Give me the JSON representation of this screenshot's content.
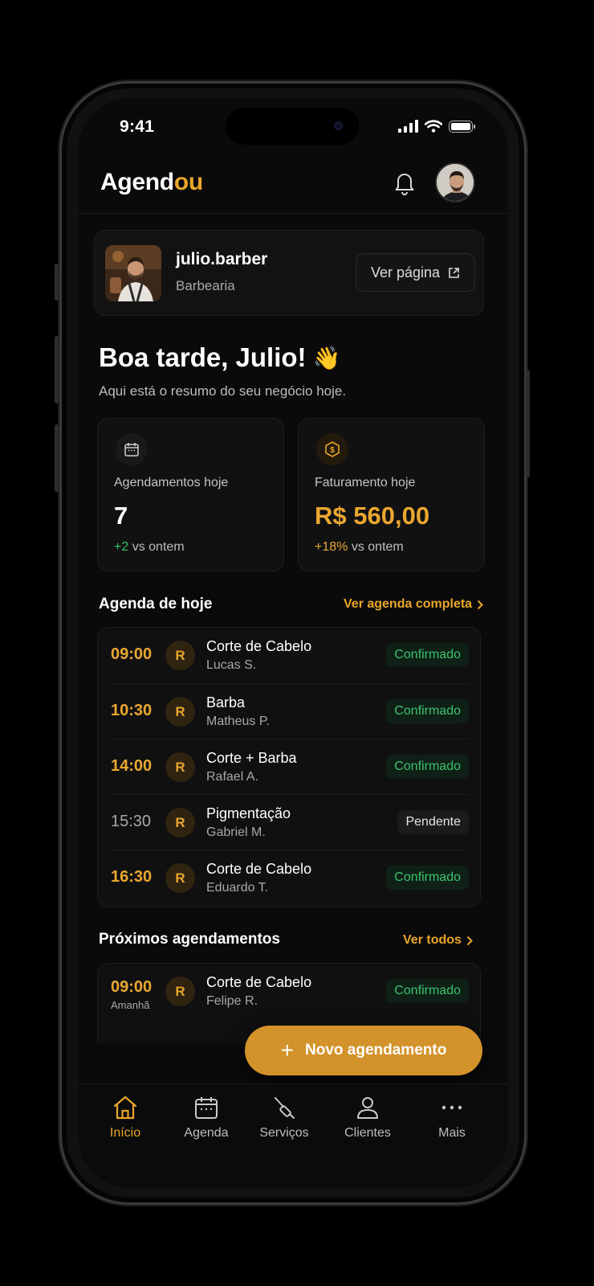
{
  "status_bar": {
    "time": "9:41"
  },
  "header": {
    "logo_main": "Agend",
    "logo_accent": "ou"
  },
  "profile": {
    "handle": "julio.barber",
    "category": "Barbearia",
    "view_page_label": "Ver página"
  },
  "greeting": {
    "title": "Boa tarde, Julio!",
    "emoji": "👋",
    "subtitle": "Aqui está o resumo do seu negócio hoje."
  },
  "stats": [
    {
      "label": "Agendamentos hoje",
      "value": "7",
      "delta": "+2",
      "delta_suffix": "vs ontem"
    },
    {
      "label": "Faturamento hoje",
      "value": "R$ 560,00",
      "delta": "+18%",
      "delta_suffix": "vs ontem"
    }
  ],
  "today": {
    "title": "Agenda de hoje",
    "link": "Ver agenda completa",
    "appointments": [
      {
        "time": "09:00",
        "initial": "R",
        "service": "Corte de Cabelo",
        "client": "Lucas S.",
        "status": "Confirmado"
      },
      {
        "time": "10:30",
        "initial": "R",
        "service": "Barba",
        "client": "Matheus P.",
        "status": "Confirmado"
      },
      {
        "time": "14:00",
        "initial": "R",
        "service": "Corte + Barba",
        "client": "Rafael A.",
        "status": "Confirmado"
      },
      {
        "time": "15:30",
        "initial": "R",
        "service": "Pigmentação",
        "client": "Gabriel M.",
        "status": "Pendente"
      },
      {
        "time": "16:30",
        "initial": "R",
        "service": "Corte de Cabelo",
        "client": "Eduardo T.",
        "status": "Confirmado"
      }
    ]
  },
  "upcoming": {
    "title": "Próximos agendamentos",
    "link": "Ver todos",
    "appointments": [
      {
        "time": "09:00",
        "day": "Amanhã",
        "initial": "R",
        "service": "Corte de Cabelo",
        "client": "Felipe R.",
        "status": "Confirmado"
      }
    ]
  },
  "fab": {
    "label": "Novo agendamento"
  },
  "tabbar": [
    {
      "label": "Início",
      "icon": "home-icon",
      "active": true
    },
    {
      "label": "Agenda",
      "icon": "calendar-icon"
    },
    {
      "label": "Serviços",
      "icon": "razor-icon"
    },
    {
      "label": "Clientes",
      "icon": "user-icon"
    },
    {
      "label": "Mais",
      "icon": "more-icon"
    }
  ],
  "colors": {
    "accent": "#e9a52a",
    "success": "#3cc36d",
    "background": "#0a0a0a"
  }
}
